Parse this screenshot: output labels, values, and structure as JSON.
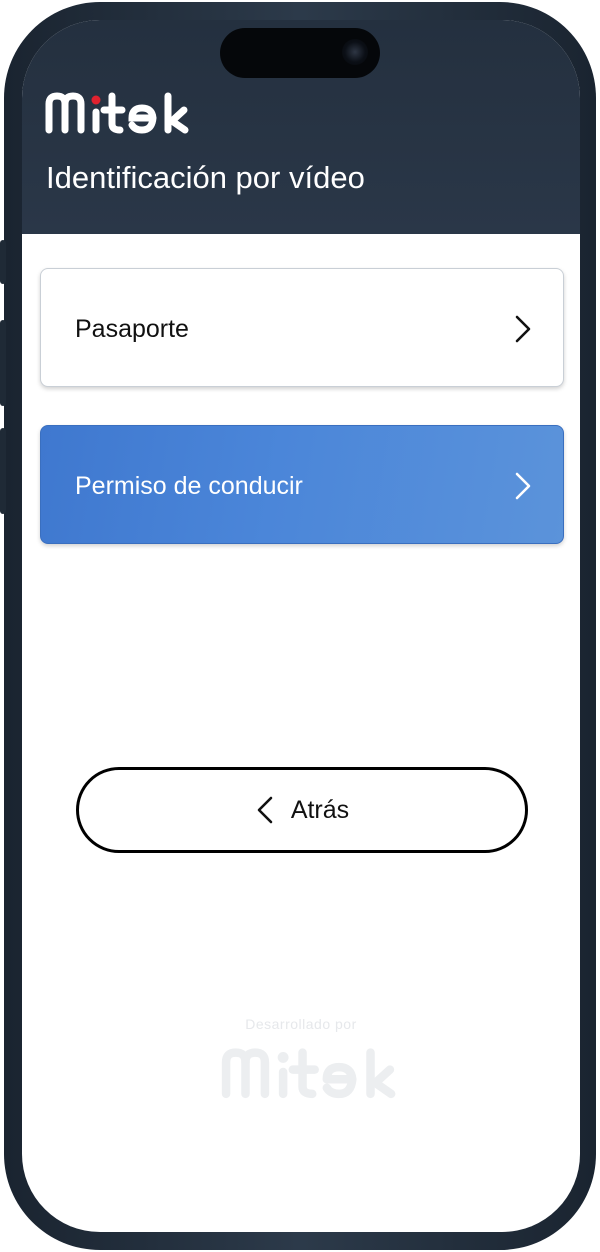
{
  "app": {
    "brand": "Mitek",
    "page_title": "Identificación por vídeo"
  },
  "options": [
    {
      "label": "Pasaporte",
      "selected": false
    },
    {
      "label": "Permiso de conducir",
      "selected": true
    }
  ],
  "navigation": {
    "back_label": "Atrás"
  },
  "footer": {
    "powered_by": "Desarrollado por",
    "brand": "Mitek"
  },
  "colors": {
    "header_bg": "#24303f",
    "selected_option_bg": "#4a84d6",
    "brand_accent": "#e0222f"
  },
  "icons": {
    "option_arrow": "chevron-right-icon",
    "back_arrow": "chevron-left-icon"
  }
}
